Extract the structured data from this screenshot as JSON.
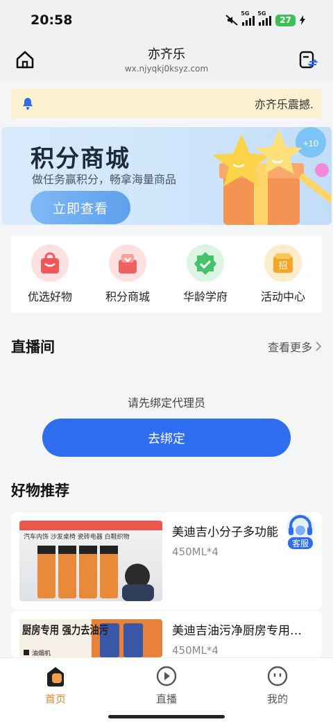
{
  "status_bar": {
    "time": "20:58",
    "net1": "5G",
    "net2": "5G",
    "battery": "27"
  },
  "header": {
    "title": "亦齐乐",
    "url": "wx.njyqkj0ksyz.com"
  },
  "notice": {
    "text": "亦齐乐震撼."
  },
  "banner": {
    "title": "积分商城",
    "subtitle": "做任务赢积分，畅拿海量商品",
    "button": "立即查看",
    "badge": "+10"
  },
  "quick_nav": [
    {
      "label": "优选好物",
      "icon": "shopping-bag-icon",
      "color": "#f0575a"
    },
    {
      "label": "积分商城",
      "icon": "gift-box-icon",
      "color": "#f06060"
    },
    {
      "label": "华龄学府",
      "icon": "check-badge-icon",
      "color": "#45c26a"
    },
    {
      "label": "活动中心",
      "icon": "event-ticket-icon",
      "color": "#f5a623"
    }
  ],
  "live": {
    "title": "直播间",
    "see_more": "查看更多",
    "empty_text": "请先绑定代理员",
    "bind_button": "去绑定"
  },
  "recommend": {
    "title": "好物推荐",
    "products": [
      {
        "name": "美迪吉小分子多功能",
        "spec": "450ML*4",
        "img_caption": "汽车内饰 沙发桌椅 瓷砖电器 白鞋织物"
      },
      {
        "name": "美迪吉油污净厨房专用…",
        "spec": "450ML*4",
        "img_caption": "厨房专用 强力去油污",
        "img_tag": "油烟机"
      }
    ]
  },
  "customer_service": {
    "label": "客服"
  },
  "tabbar": [
    {
      "label": "首页",
      "icon": "home-icon",
      "active": true
    },
    {
      "label": "直播",
      "icon": "play-icon",
      "active": false
    },
    {
      "label": "我的",
      "icon": "profile-face-icon",
      "active": false
    }
  ],
  "colors": {
    "accent": "#2e6cf0",
    "tab_active": "#e8832f",
    "notice_bg": "#fbf0cf"
  }
}
